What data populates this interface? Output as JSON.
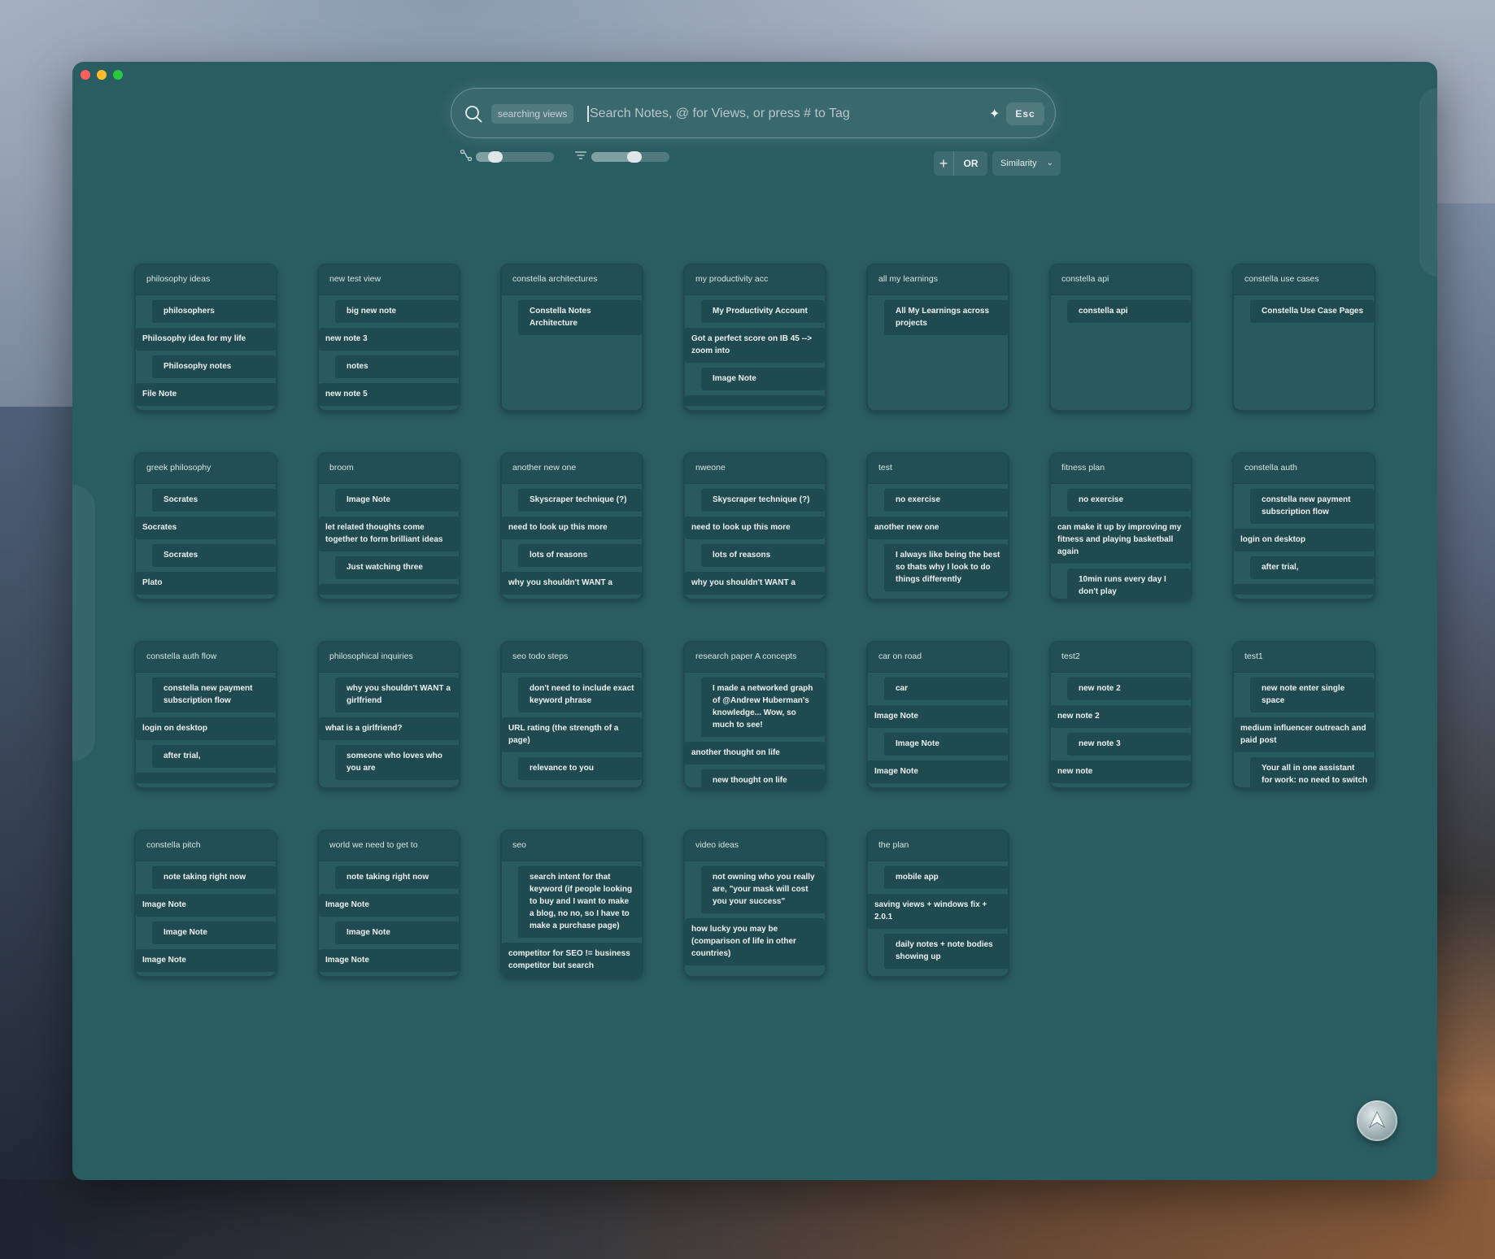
{
  "window": {
    "controls": [
      "close",
      "minimize",
      "zoom"
    ]
  },
  "search": {
    "mode_chip": "searching views",
    "placeholder": "Search Notes, @ for Views, or press # to Tag",
    "esc_label": "Esc",
    "icons": {
      "search": "search-icon",
      "ai": "sparkle-icon"
    }
  },
  "controls": {
    "connection_slider": {
      "icon": "link-slider-icon",
      "value": 0.25
    },
    "filter_slider": {
      "icon": "filter-icon",
      "value": 0.55
    },
    "add_label": "+",
    "or_label": "OR",
    "sort_label": "Similarity"
  },
  "views": [
    {
      "title": "philosophy ideas",
      "notes": [
        {
          "text": "philosophers",
          "indent": true
        },
        {
          "text": "Philosophy idea for my life",
          "indent": false
        },
        {
          "text": "Philosophy notes",
          "indent": true
        },
        {
          "text": "File Note",
          "indent": false
        }
      ]
    },
    {
      "title": "new test view",
      "notes": [
        {
          "text": "big new note",
          "indent": true
        },
        {
          "text": "new note 3",
          "indent": false
        },
        {
          "text": "notes",
          "indent": true
        },
        {
          "text": "new note 5",
          "indent": false
        }
      ]
    },
    {
      "title": "constella architectures",
      "notes": [
        {
          "text": "Constella Notes Architecture",
          "indent": true
        }
      ]
    },
    {
      "title": "my productivity acc",
      "notes": [
        {
          "text": "My Productivity Account",
          "indent": true
        },
        {
          "text": "Got a perfect score on IB 45 --> zoom into",
          "indent": false
        },
        {
          "text": "Image Note",
          "indent": true
        },
        {
          "text": "",
          "indent": false
        }
      ]
    },
    {
      "title": "all my learnings",
      "notes": [
        {
          "text": "All My Learnings across projects",
          "indent": true
        }
      ]
    },
    {
      "title": "constella api",
      "notes": [
        {
          "text": "constella api",
          "indent": true
        }
      ]
    },
    {
      "title": "constella use cases",
      "notes": [
        {
          "text": "Constella Use Case Pages",
          "indent": true
        }
      ]
    },
    {
      "title": "greek philosophy",
      "notes": [
        {
          "text": "Socrates",
          "indent": true
        },
        {
          "text": "Socrates",
          "indent": false
        },
        {
          "text": "Socrates",
          "indent": true
        },
        {
          "text": "Plato",
          "indent": false
        }
      ]
    },
    {
      "title": "broom",
      "notes": [
        {
          "text": "Image Note",
          "indent": true
        },
        {
          "text": "let related thoughts come together to form brilliant ideas",
          "indent": false
        },
        {
          "text": "Just watching three",
          "indent": true
        },
        {
          "text": "",
          "indent": false
        }
      ]
    },
    {
      "title": "another new one",
      "notes": [
        {
          "text": "Skyscraper technique (?)",
          "indent": true
        },
        {
          "text": "need to look up this more",
          "indent": false
        },
        {
          "text": "lots of reasons",
          "indent": true
        },
        {
          "text": "why you shouldn't WANT a",
          "indent": false
        }
      ]
    },
    {
      "title": "nweone",
      "notes": [
        {
          "text": "Skyscraper technique (?)",
          "indent": true
        },
        {
          "text": "need to look up this more",
          "indent": false
        },
        {
          "text": "lots of reasons",
          "indent": true
        },
        {
          "text": "why you shouldn't WANT a",
          "indent": false
        }
      ]
    },
    {
      "title": "test",
      "notes": [
        {
          "text": "no exercise",
          "indent": true
        },
        {
          "text": "another new one",
          "indent": false
        },
        {
          "text": "I always like being the best so thats why I look to do things differently",
          "indent": true
        }
      ]
    },
    {
      "title": "fitness plan",
      "notes": [
        {
          "text": "no exercise",
          "indent": true
        },
        {
          "text": "can make it up by improving my fitness and playing basketball again",
          "indent": false
        },
        {
          "text": "10min runs every day I don't play",
          "indent": true
        }
      ]
    },
    {
      "title": "constella auth",
      "notes": [
        {
          "text": "constella new payment subscription flow",
          "indent": true
        },
        {
          "text": "login on desktop",
          "indent": false
        },
        {
          "text": "after trial,",
          "indent": true
        },
        {
          "text": "",
          "indent": false
        }
      ]
    },
    {
      "title": "constella auth flow",
      "notes": [
        {
          "text": "constella new payment subscription flow",
          "indent": true
        },
        {
          "text": "login on desktop",
          "indent": false
        },
        {
          "text": "after trial,",
          "indent": true
        },
        {
          "text": "",
          "indent": false
        }
      ]
    },
    {
      "title": "philosophical inquiries",
      "notes": [
        {
          "text": "why you shouldn't WANT a girlfriend",
          "indent": true
        },
        {
          "text": "what is a girlfriend?",
          "indent": false
        },
        {
          "text": "someone who loves who you are",
          "indent": true
        }
      ]
    },
    {
      "title": "seo todo steps",
      "notes": [
        {
          "text": "don't need to include exact keyword phrase",
          "indent": true
        },
        {
          "text": "URL rating (the strength of a page)",
          "indent": false
        },
        {
          "text": "relevance to you",
          "indent": true
        }
      ]
    },
    {
      "title": "research paper A concepts",
      "notes": [
        {
          "text": "I made a networked graph of @Andrew Huberman's knowledge... Wow, so much to see!",
          "indent": true
        },
        {
          "text": "another thought on life",
          "indent": false
        },
        {
          "text": "new thought on life",
          "indent": true
        }
      ]
    },
    {
      "title": "car on road",
      "notes": [
        {
          "text": "car",
          "indent": true
        },
        {
          "text": "Image Note",
          "indent": false
        },
        {
          "text": "Image Note",
          "indent": true
        },
        {
          "text": "Image Note",
          "indent": false
        }
      ]
    },
    {
      "title": "test2",
      "notes": [
        {
          "text": "new note 2",
          "indent": true
        },
        {
          "text": "new note 2",
          "indent": false
        },
        {
          "text": "new note 3",
          "indent": true
        },
        {
          "text": "new note",
          "indent": false
        }
      ]
    },
    {
      "title": "test1",
      "notes": [
        {
          "text": "new note enter single space",
          "indent": true
        },
        {
          "text": "medium influencer outreach and paid post",
          "indent": false
        },
        {
          "text": "Your all in one assistant for work: no need to switch apps",
          "indent": true
        }
      ]
    },
    {
      "title": "constella pitch",
      "notes": [
        {
          "text": "note taking right now",
          "indent": true
        },
        {
          "text": "Image Note",
          "indent": false
        },
        {
          "text": "Image Note",
          "indent": true
        },
        {
          "text": "Image Note",
          "indent": false
        }
      ]
    },
    {
      "title": "world we need to get to",
      "notes": [
        {
          "text": "note taking right now",
          "indent": true
        },
        {
          "text": "Image Note",
          "indent": false
        },
        {
          "text": "Image Note",
          "indent": true
        },
        {
          "text": "Image Note",
          "indent": false
        }
      ]
    },
    {
      "title": "seo",
      "notes": [
        {
          "text": "search intent for that keyword (if people looking to buy and I want to make a blog, no no, so I have to make a purchase page)",
          "indent": true
        },
        {
          "text": "competitor for SEO != business competitor but search",
          "indent": false
        }
      ]
    },
    {
      "title": "video ideas",
      "notes": [
        {
          "text": "not owning who you really are, \"your mask will cost you your success\"",
          "indent": true
        },
        {
          "text": "how lucky you may be (comparison of life in other countries)",
          "indent": false
        }
      ]
    },
    {
      "title": "the plan",
      "notes": [
        {
          "text": "mobile app",
          "indent": true
        },
        {
          "text": "saving views + windows fix + 2.0.1",
          "indent": false
        },
        {
          "text": "daily notes + note bodies showing up",
          "indent": true
        }
      ]
    }
  ],
  "fab": {
    "icon": "constella-logo-icon"
  }
}
